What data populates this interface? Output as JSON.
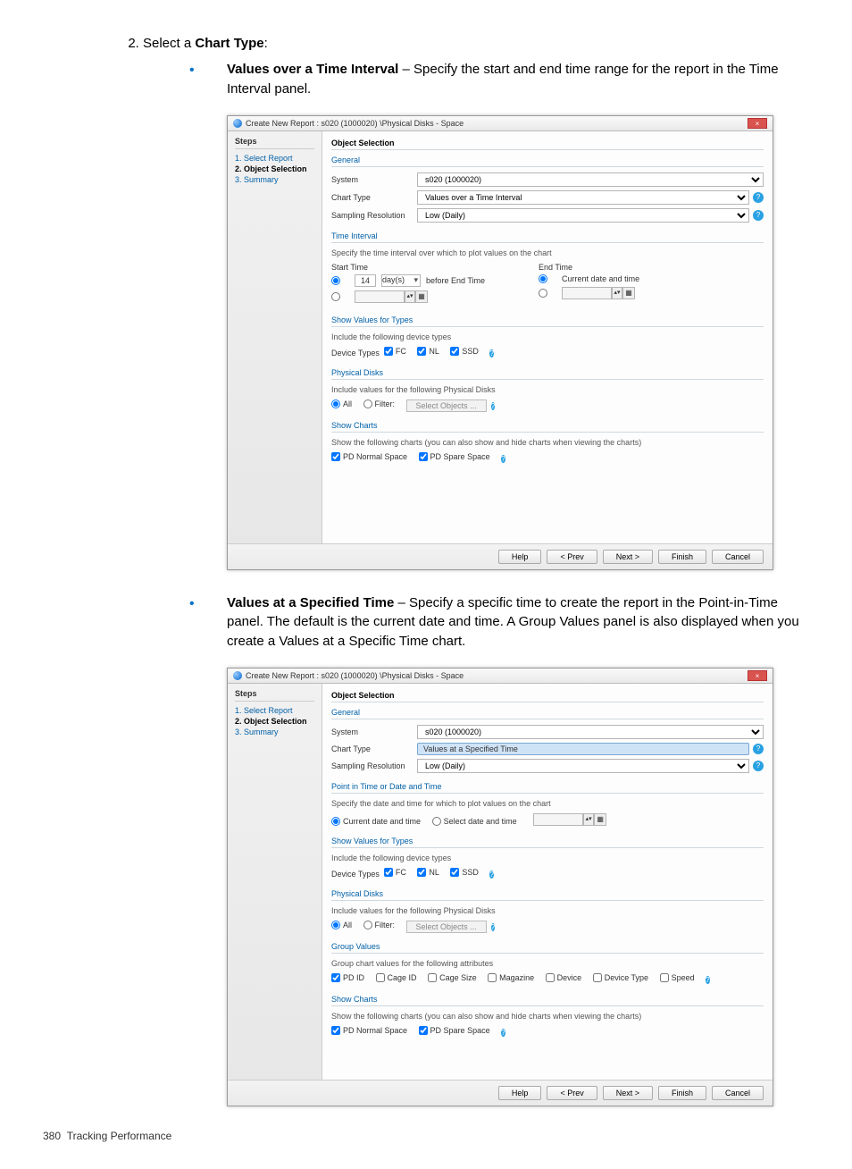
{
  "page_number": "380",
  "page_section": "Tracking Performance",
  "step": {
    "number": "2.",
    "text_prefix": "Select a ",
    "text_bold": "Chart Type",
    "text_suffix": ":"
  },
  "bullet1": {
    "term": "Values over a Time Interval",
    "desc": " – Specify the start and end time range for the report in the Time Interval panel."
  },
  "bullet2": {
    "term": "Values at a Specified Time",
    "desc": " – Specify a specific time to create the report in the Point-in-Time panel. The default is the current date and time. A Group Values panel is also displayed when you create a Values at a Specific Time chart."
  },
  "dialog_common": {
    "title": "Create New Report : s020 (1000020) \\Physical Disks - Space",
    "steps_header": "Steps",
    "step1": "1. Select Report",
    "step2": "2. Object Selection",
    "step3": "3. Summary",
    "content_header": "Object Selection",
    "general": "General",
    "lbl_system": "System",
    "val_system": "s020 (1000020)",
    "lbl_chart_type": "Chart Type",
    "lbl_sampling": "Sampling Resolution",
    "val_sampling": "Low (Daily)",
    "show_values_head": "Show Values for Types",
    "show_values_desc": "Include the following device types",
    "device_types_lbl": "Device Types",
    "dt_fc": "FC",
    "dt_nl": "NL",
    "dt_ssd": "SSD",
    "physical_disks_head": "Physical Disks",
    "physical_disks_desc": "Include values for the following Physical Disks",
    "pd_all": "All",
    "pd_filter": "Filter:",
    "pd_select_objects": "Select Objects ...",
    "show_charts_head": "Show Charts",
    "show_charts_desc": "Show the following charts (you can also show and hide charts when viewing the charts)",
    "sc_normal": "PD Normal Space",
    "sc_spare": "PD Spare Space",
    "btn_help": "Help",
    "btn_prev": "< Prev",
    "btn_next": "Next >",
    "btn_finish": "Finish",
    "btn_cancel": "Cancel"
  },
  "dialog1": {
    "val_chart_type": "Values over a Time Interval",
    "time_interval_head": "Time Interval",
    "time_interval_desc": "Specify the time interval over which to plot values on the chart",
    "start_time": "Start Time",
    "end_time": "End Time",
    "spn_val": "14",
    "unit": "day(s)",
    "before_end": "before End Time",
    "current_dt": "Current date and time"
  },
  "dialog2": {
    "val_chart_type": "Values at a Specified Time",
    "pit_head": "Point in Time or Date and Time",
    "pit_desc": "Specify the date and time for which to plot values on the chart",
    "pit_current": "Current date and time",
    "pit_select": "Select date and time",
    "group_head": "Group Values",
    "group_desc": "Group chart values for the following attributes",
    "gv_pdid": "PD ID",
    "gv_cageid": "Cage ID",
    "gv_cagesize": "Cage Size",
    "gv_magazine": "Magazine",
    "gv_device": "Device",
    "gv_device_type": "Device Type",
    "gv_speed": "Speed"
  }
}
